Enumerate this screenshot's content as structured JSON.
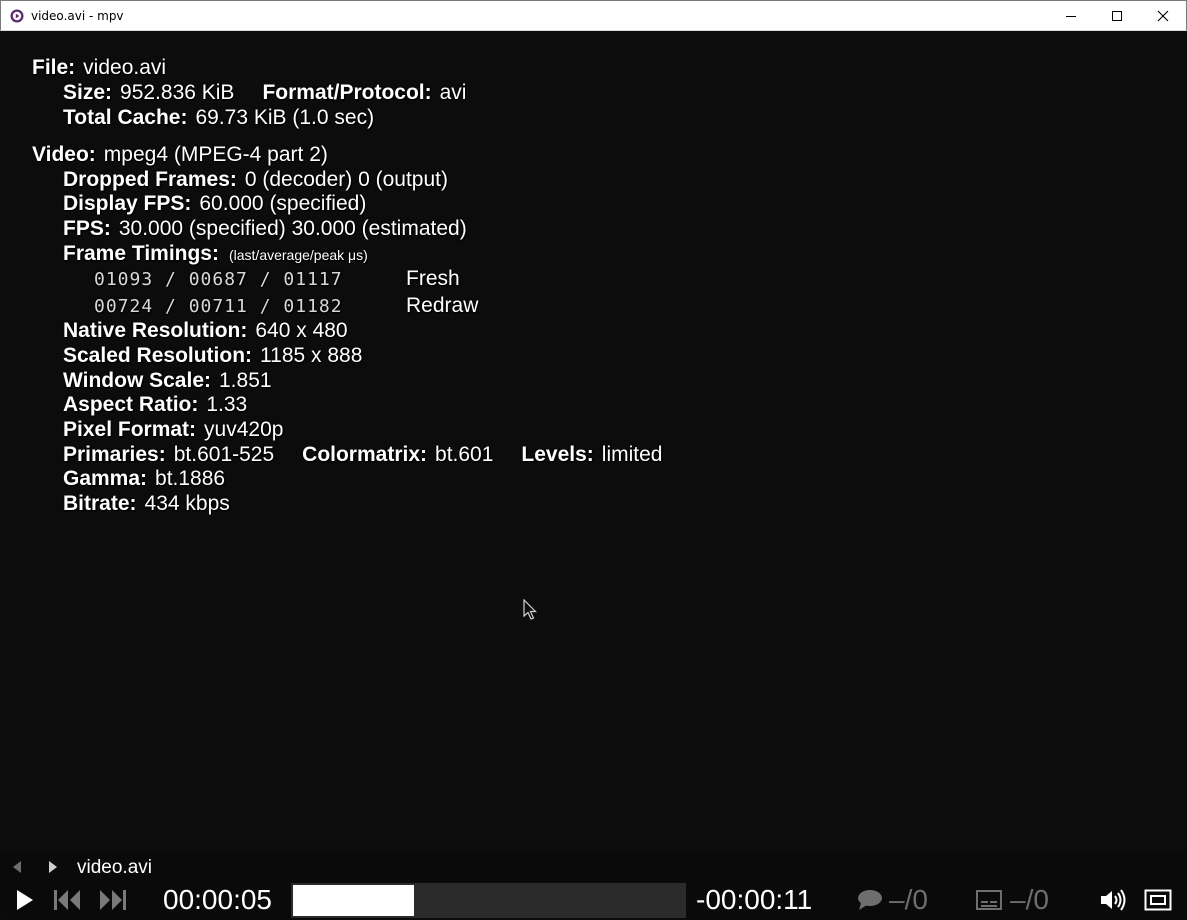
{
  "window": {
    "title": "video.avi - mpv",
    "icon": "mpv-logo-icon",
    "controls": [
      "minimize-icon",
      "maximize-icon",
      "close-icon"
    ]
  },
  "stats": {
    "file_key": "File:",
    "file_val": "video.avi",
    "size_key": "Size:",
    "size_val": "952.836 KiB",
    "format_key": "Format/Protocol:",
    "format_val": "avi",
    "cache_key": "Total Cache:",
    "cache_val": "69.73 KiB  (1.0 sec)",
    "video_key": "Video:",
    "video_val": "mpeg4 (MPEG-4 part 2)",
    "dropped_key": "Dropped Frames:",
    "dropped_val": "0 (decoder)  0 (output)",
    "dfps_key": "Display FPS:",
    "dfps_val": "60.000 (specified)",
    "fps_key": "FPS:",
    "fps_val": "30.000 (specified)  30.000 (estimated)",
    "timings_key": "Frame Timings:",
    "timings_unit": "(last/average/peak  μs)",
    "timing_fresh": "01093 / 00687 / 01117",
    "timing_fresh_label": "Fresh",
    "timing_redraw": "00724 / 00711 / 01182",
    "timing_redraw_label": "Redraw",
    "native_key": "Native Resolution:",
    "native_val": "640 x 480",
    "scaled_key": "Scaled Resolution:",
    "scaled_val": "1185 x 888",
    "wscale_key": "Window Scale:",
    "wscale_val": "1.851",
    "aspect_key": "Aspect Ratio:",
    "aspect_val": "1.33",
    "pixfmt_key": "Pixel Format:",
    "pixfmt_val": "yuv420p",
    "primaries_key": "Primaries:",
    "primaries_val": "bt.601-525",
    "colormatrix_key": "Colormatrix:",
    "colormatrix_val": "bt.601",
    "levels_key": "Levels:",
    "levels_val": "limited",
    "gamma_key": "Gamma:",
    "gamma_val": "bt.1886",
    "bitrate_key": "Bitrate:",
    "bitrate_val": "434 kbps"
  },
  "osc": {
    "media_title": "video.avi",
    "time_position": "00:00:05",
    "time_remaining": "-00:00:11",
    "seek_progress": 0.31,
    "audio_track": "–/0",
    "subtitle_track": "–/0",
    "icons": [
      "playlist-prev-icon",
      "playlist-next-icon",
      "play-icon",
      "skip-back-icon",
      "skip-forward-icon",
      "audio-track-icon",
      "subtitle-icon",
      "volume-icon",
      "fullscreen-icon"
    ]
  }
}
